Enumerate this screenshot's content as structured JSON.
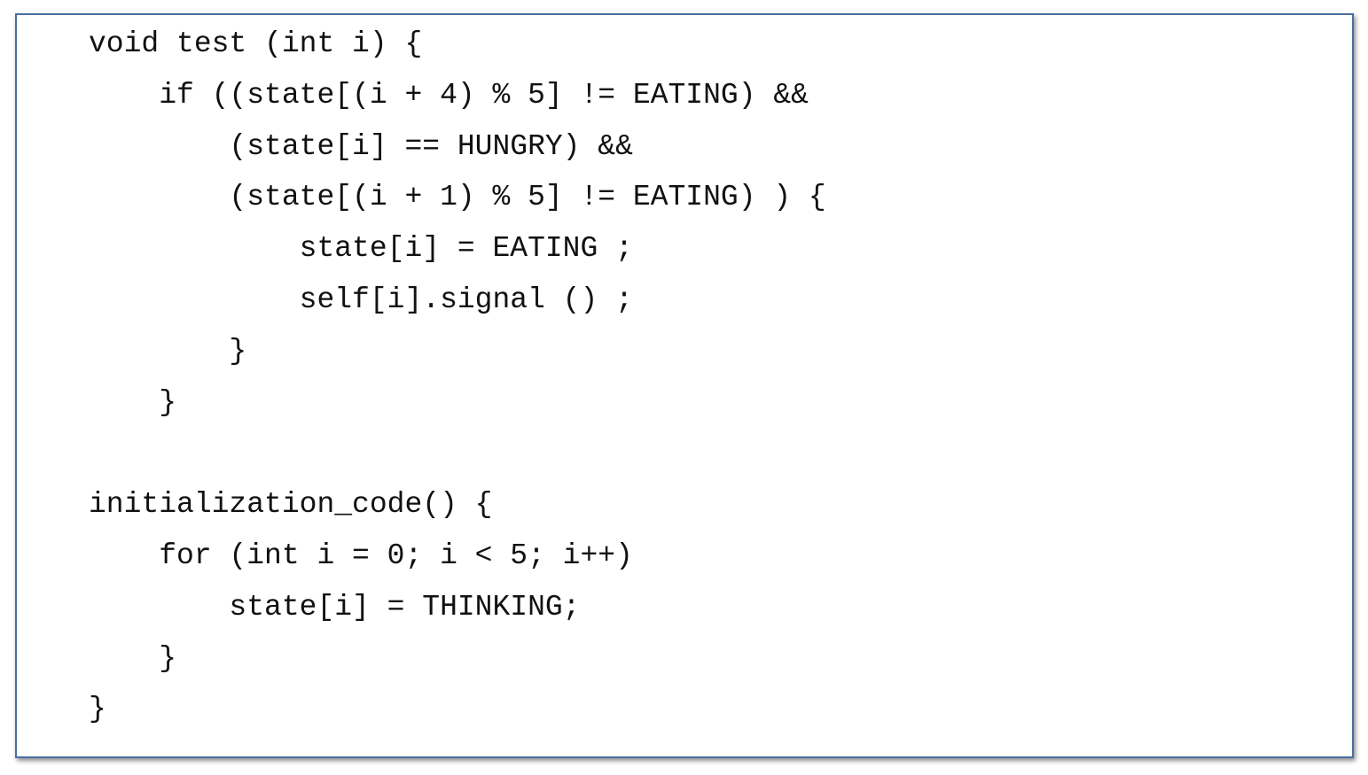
{
  "code": {
    "lines": [
      "void test (int i) {",
      "    if ((state[(i + 4) % 5] != EATING) &&",
      "        (state[i] == HUNGRY) &&",
      "        (state[(i + 1) % 5] != EATING) ) {",
      "            state[i] = EATING ;",
      "            self[i].signal () ;",
      "        }",
      "    }",
      "",
      "initialization_code() {",
      "    for (int i = 0; i < 5; i++)",
      "        state[i] = THINKING;",
      "    }",
      "}"
    ]
  }
}
